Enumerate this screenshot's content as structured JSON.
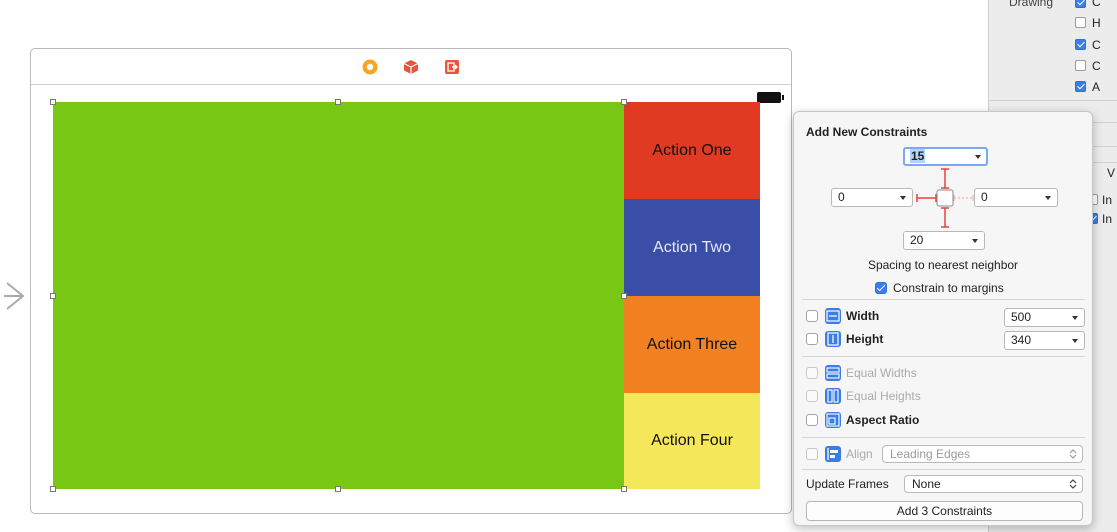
{
  "inspector": {
    "section_label": "Drawing",
    "rows": [
      {
        "letter": "C",
        "checked": true
      },
      {
        "letter": "H",
        "checked": false
      },
      {
        "letter": "C",
        "checked": true
      },
      {
        "letter": "C",
        "checked": false
      },
      {
        "letter": "A",
        "checked": true
      }
    ],
    "lower_rows": [
      {
        "letter": "V"
      },
      {
        "letter": "In",
        "checked": false
      },
      {
        "letter": "In",
        "checked": true
      }
    ]
  },
  "scene": {
    "dock_icons": [
      "view-controller-icon",
      "first-responder-icon",
      "exit-icon"
    ],
    "actions": [
      {
        "label": "Action One",
        "color": "#e03a22",
        "text_color": "#111111"
      },
      {
        "label": "Action Two",
        "color": "#3a4ea8",
        "text_color": "#e6e9f5"
      },
      {
        "label": "Action Three",
        "color": "#f28122",
        "text_color": "#111111"
      },
      {
        "label": "Action Four",
        "color": "#f4e85a",
        "text_color": "#111111"
      }
    ],
    "main_view_color": "#77c714"
  },
  "constraints": {
    "title": "Add New Constraints",
    "top": "15",
    "left": "0",
    "right": "0",
    "bottom": "20",
    "spacing_caption": "Spacing to nearest neighbor",
    "constrain_margins": {
      "label": "Constrain to margins",
      "checked": true
    },
    "width": {
      "label": "Width",
      "value": "500",
      "checked": false
    },
    "height": {
      "label": "Height",
      "value": "340",
      "checked": false
    },
    "equal_widths": {
      "label": "Equal Widths",
      "checked": false
    },
    "equal_heights": {
      "label": "Equal Heights",
      "checked": false
    },
    "aspect_ratio": {
      "label": "Aspect Ratio",
      "checked": false
    },
    "align": {
      "label": "Align",
      "value": "Leading Edges",
      "checked": false
    },
    "update_frames": {
      "label": "Update Frames",
      "value": "None"
    },
    "add_button": "Add 3 Constraints",
    "accent_color": "#3a7ee8",
    "strut_color": "#e8443a"
  }
}
